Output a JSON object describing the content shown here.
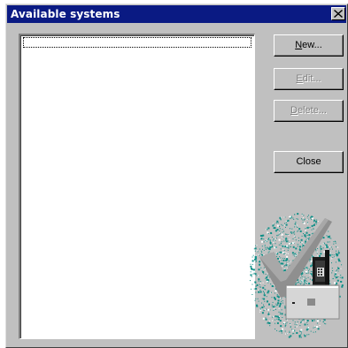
{
  "window": {
    "title": "Available systems",
    "close_glyph": "✕"
  },
  "list": {
    "items": []
  },
  "buttons": {
    "new": {
      "mnemonic": "N",
      "rest": "ew...",
      "enabled": true
    },
    "edit": {
      "mnemonic": "E",
      "rest": "dit...",
      "enabled": false
    },
    "delete": {
      "mnemonic": "D",
      "rest": "elete...",
      "enabled": false
    },
    "close": {
      "label": "Close",
      "enabled": true
    }
  },
  "illustration": {
    "icon": "checkmark-phone-modem-illustration",
    "colors": {
      "splash": "#0f8f87",
      "check": "#8a8a8a",
      "device": "#d9d9d9"
    }
  }
}
